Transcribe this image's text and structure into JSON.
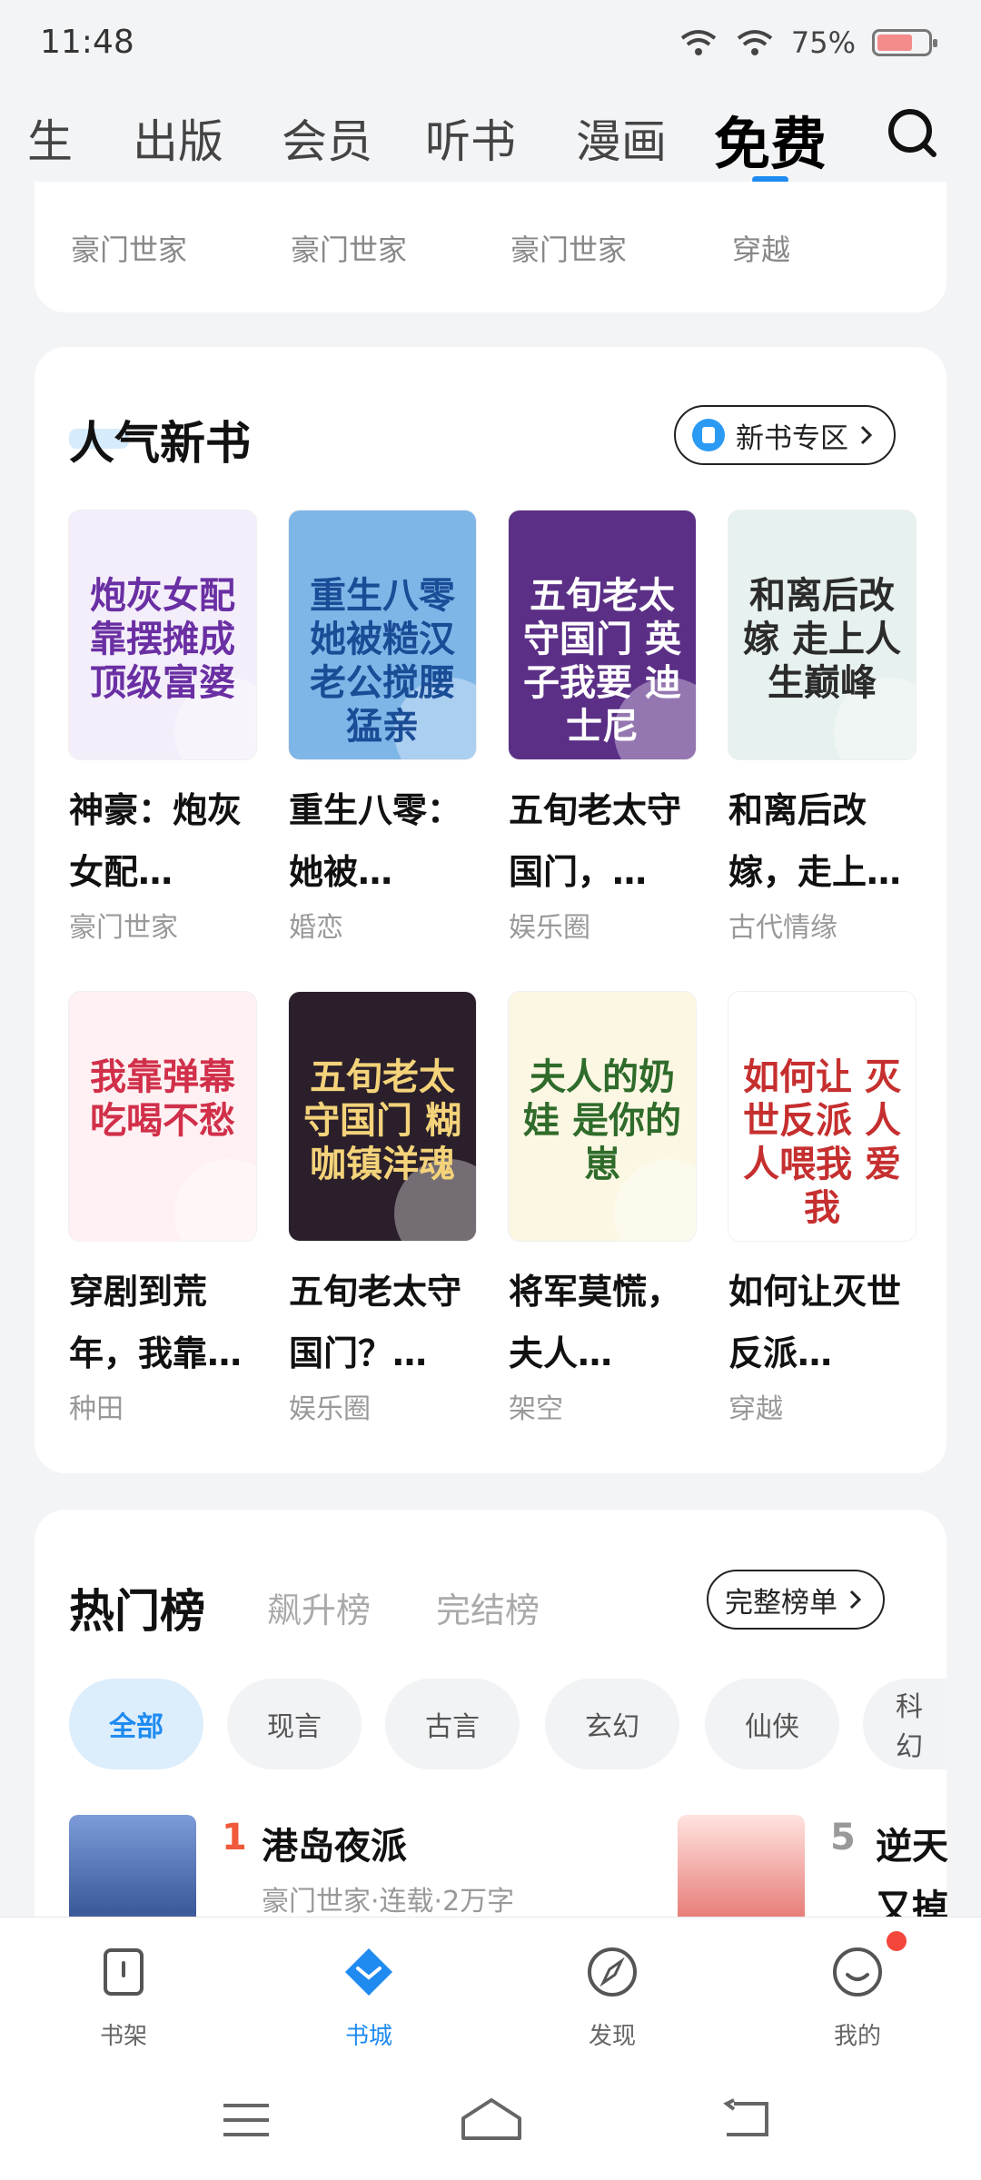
{
  "status": {
    "time": "11:48",
    "battery": "75%"
  },
  "top_tabs": [
    "生",
    "出版",
    "会员",
    "听书",
    "漫画",
    "免费"
  ],
  "top_active": "免费",
  "prev_genres": [
    "豪门世家",
    "豪门世家",
    "豪门世家",
    "穿越"
  ],
  "new_books": {
    "title": "人气新书",
    "zone_button": "新书专区",
    "books": [
      {
        "title": "神豪：炮灰女配…",
        "genre": "豪门世家",
        "cover_text": "炮灰女配 靠摆摊成 顶级富婆",
        "cover_color": "#f4eefb",
        "text_color": "#6a2fa3"
      },
      {
        "title": "重生八零：她被…",
        "genre": "婚恋",
        "cover_text": "重生八零 她被糙汉 老公搅腰 猛亲",
        "cover_color": "#7fb6e8",
        "text_color": "#1b4c96"
      },
      {
        "title": "五旬老太守国门，…",
        "genre": "娱乐圈",
        "cover_text": "五旬老太守国门 英子我要 迪士尼",
        "cover_color": "#5b2f86",
        "text_color": "#ffffff"
      },
      {
        "title": "和离后改嫁，走上…",
        "genre": "古代情缘",
        "cover_text": "和离后改嫁 走上人生巅峰",
        "cover_color": "#e7f1ef",
        "text_color": "#2b2b2b"
      },
      {
        "title": "穿剧到荒年，我靠…",
        "genre": "种田",
        "cover_text": "我靠弹幕 吃喝不愁",
        "cover_color": "#fff1f3",
        "text_color": "#d1304a"
      },
      {
        "title": "五旬老太守国门？…",
        "genre": "娱乐圈",
        "cover_text": "五旬老太守国门 糊咖镇洋魂",
        "cover_color": "#2a1f2a",
        "text_color": "#f4d37a"
      },
      {
        "title": "将军莫慌，夫人…",
        "genre": "架空",
        "cover_text": "夫人的奶娃 是你的崽",
        "cover_color": "#fbf7e3",
        "text_color": "#2f6b2a"
      },
      {
        "title": "如何让灭世反派…",
        "genre": "穿越",
        "cover_text": "如何让 灭世反派 人人喂我 爱我",
        "cover_color": "#ffffff",
        "text_color": "#c62f2f"
      }
    ]
  },
  "ranking": {
    "title": "热门榜",
    "tabs": [
      "飙升榜",
      "完结榜"
    ],
    "full_button": "完整榜单",
    "chips": [
      "全部",
      "现言",
      "古言",
      "玄幻",
      "仙侠",
      "科幻"
    ],
    "items": [
      {
        "rank": "1",
        "title": "港岛夜派",
        "meta": "豪门世家·连载·2万字",
        "cover_color": "#3a5a9b"
      },
      {
        "rank": "5",
        "title": "逆天",
        "meta": "又掉",
        "cover_color": "#d9423b"
      }
    ]
  },
  "bottom_nav": [
    "书架",
    "书城",
    "发现",
    "我的"
  ],
  "colors": {
    "accent": "#1f8bf0",
    "badge_red": "#f5463c"
  }
}
